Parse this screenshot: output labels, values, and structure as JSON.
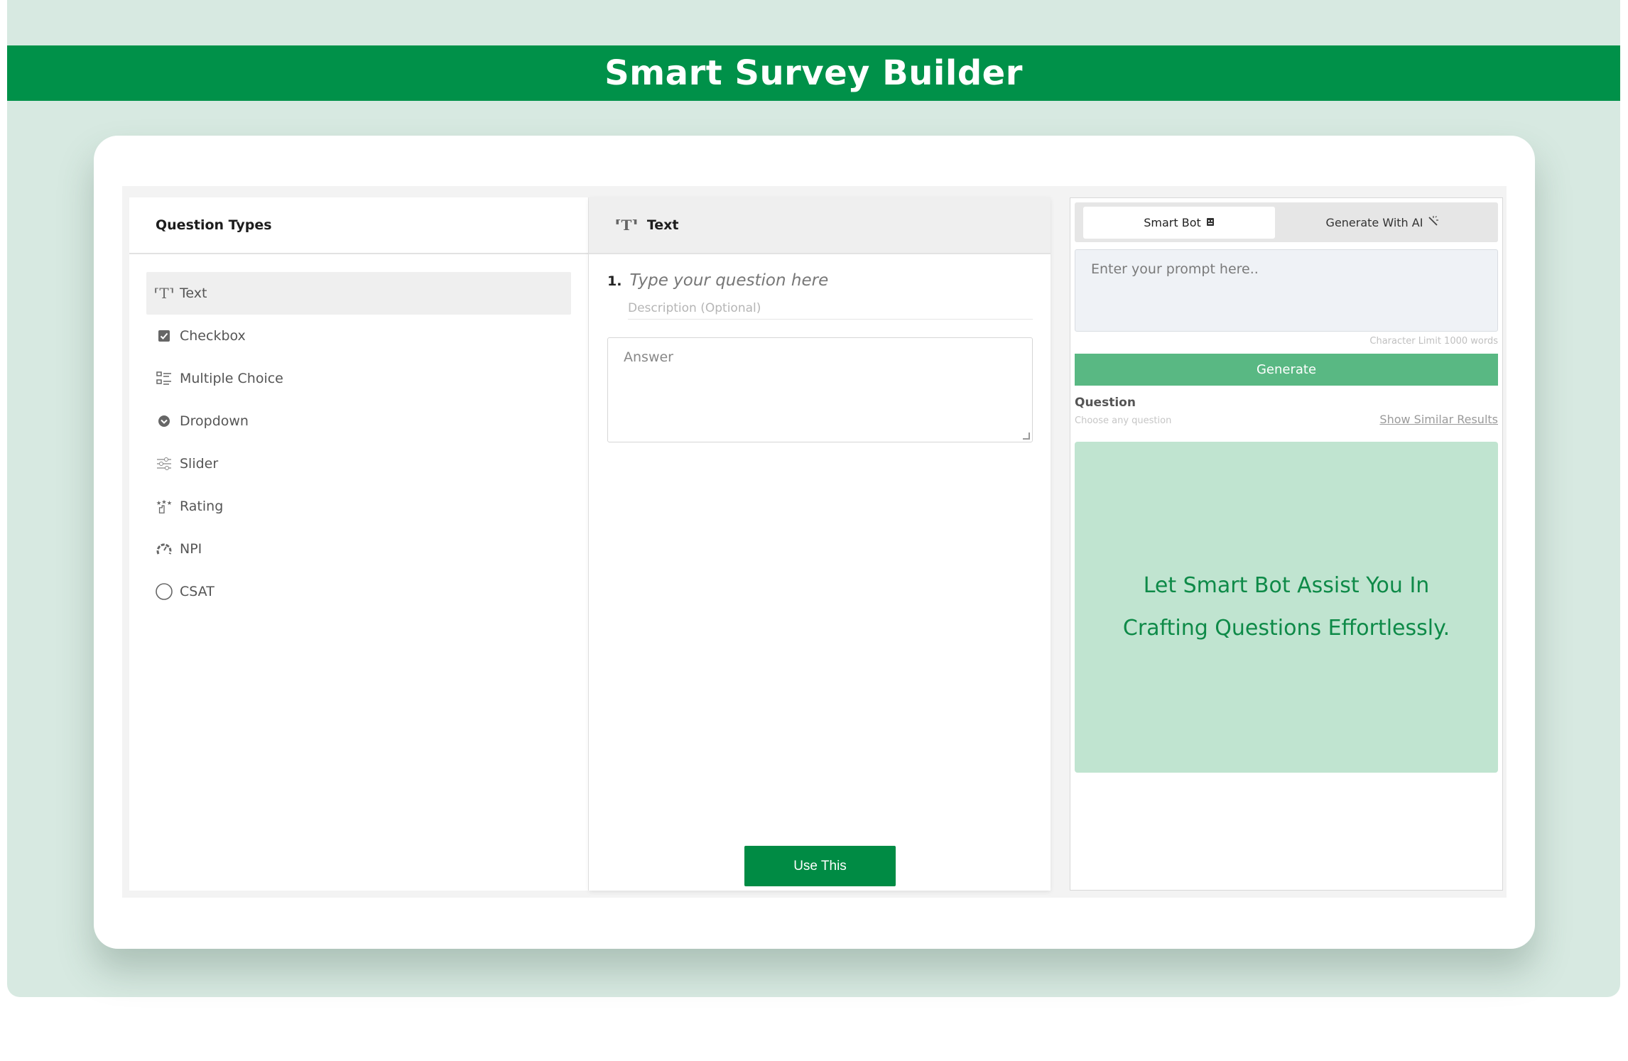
{
  "app": {
    "title": "Smart Survey Builder"
  },
  "question_types": {
    "heading": "Question Types",
    "items": [
      {
        "label": "Text",
        "icon": "text-icon",
        "active": true
      },
      {
        "label": "Checkbox",
        "icon": "checkbox-icon"
      },
      {
        "label": "Multiple Choice",
        "icon": "list-icon"
      },
      {
        "label": "Dropdown",
        "icon": "dropdown-icon"
      },
      {
        "label": "Slider",
        "icon": "slider-icon"
      },
      {
        "label": "Rating",
        "icon": "rating-icon"
      },
      {
        "label": "NPI",
        "icon": "gauge-icon"
      },
      {
        "label": "CSAT",
        "icon": "circle-icon"
      }
    ]
  },
  "editor": {
    "type_label": "Text",
    "question_number": "1.",
    "question_placeholder": "Type your question here",
    "description_placeholder": "Description (Optional)",
    "answer_placeholder": "Answer",
    "use_button": "Use This"
  },
  "assistant": {
    "tabs": [
      "Smart Bot",
      "Generate With AI"
    ],
    "prompt_placeholder": "Enter your prompt here..",
    "char_limit": "Character Limit 1000 words",
    "generate_button": "Generate",
    "question_label": "Question",
    "question_hint": "Choose any question",
    "similar_link": "Show Similar Results",
    "assist_message": "Let Smart Bot Assist You In Crafting Questions Effortlessly."
  },
  "colors": {
    "brand": "#009149",
    "accent_light": "#c0e4d0",
    "generate": "#59b883"
  }
}
